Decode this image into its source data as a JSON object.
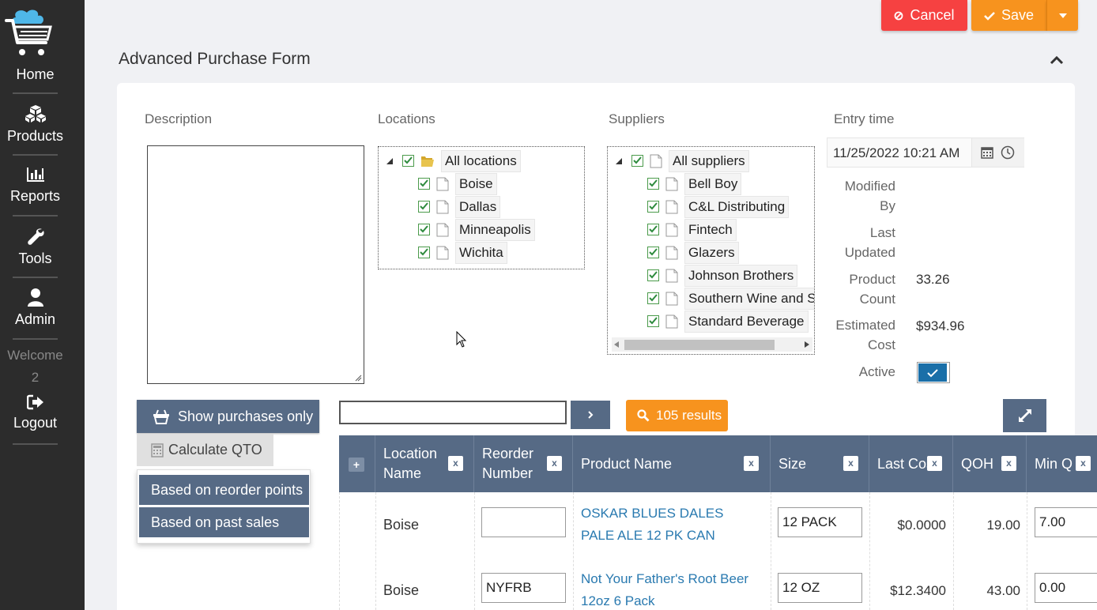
{
  "sidebar": {
    "items": [
      {
        "label": "Home",
        "icon": "cart-icon"
      },
      {
        "label": "Products",
        "icon": "boxes-icon"
      },
      {
        "label": "Reports",
        "icon": "bar-chart-icon"
      },
      {
        "label": "Tools",
        "icon": "wrench-icon"
      },
      {
        "label": "Admin",
        "icon": "user-icon"
      }
    ],
    "welcome": "Welcome",
    "user": "2",
    "logout": "Logout"
  },
  "toolbar": {
    "cancel_label": "Cancel",
    "save_label": "Save"
  },
  "form": {
    "title": "Advanced Purchase Form",
    "description_label": "Description",
    "description_value": "",
    "locations_label": "Locations",
    "locations": {
      "root": "All locations",
      "children": [
        "Boise",
        "Dallas",
        "Minneapolis",
        "Wichita"
      ]
    },
    "suppliers_label": "Suppliers",
    "suppliers": {
      "root": "All suppliers",
      "children": [
        "Bell Boy",
        "C&L Distributing",
        "Fintech",
        "Glazers",
        "Johnson Brothers",
        "Southern Wine and Sp",
        "Standard Beverage"
      ]
    },
    "entry_time_label": "Entry time",
    "entry_time_value": "11/25/2022 10:21 AM",
    "modified_by_label_1": "Modified",
    "modified_by_label_2": "By",
    "last_updated_label_1": "Last",
    "last_updated_label_2": "Updated",
    "product_count_label_1": "Product",
    "product_count_label_2": "Count",
    "product_count_value": "33.26",
    "estimated_cost_label_1": "Estimated",
    "estimated_cost_label_2": "Cost",
    "estimated_cost_value": "$934.96",
    "active_label": "Active",
    "active_value": true
  },
  "actions": {
    "show_purchases_label": "Show purchases only",
    "calculate_qto_label": "Calculate QTO",
    "qto_options": [
      "Based on reorder points",
      "Based on past sales"
    ],
    "search_value": "",
    "results_label": "105 results"
  },
  "grid": {
    "columns": [
      "Location Name",
      "Reorder Number",
      "Product Name",
      "Size",
      "Last Cost",
      "QOH",
      "Min QTY"
    ],
    "columns_display": [
      "Location",
      "Name",
      "Reorder",
      "Number",
      "Product Name",
      "Size",
      "Last Cos",
      "QOH",
      "Min Q"
    ],
    "rows": [
      {
        "location": "Boise",
        "reorder": "",
        "product_line1": "OSKAR BLUES DALES",
        "product_line2": "PALE ALE 12 PK CAN",
        "size": "12 PACK",
        "last_cost": "$0.0000",
        "qoh": "19.00",
        "min_qty": "7.00"
      },
      {
        "location": "Boise",
        "reorder": "NYFRB",
        "product_line1": "Not Your Father's Root Beer",
        "product_line2": "12oz 6 Pack",
        "size": "12 OZ",
        "last_cost": "$12.3400",
        "qoh": "43.00",
        "min_qty": "0.00"
      }
    ]
  },
  "colors": {
    "sidebar_bg": "#2c2c2c",
    "cancel": "#f64141",
    "save": "#f7931e",
    "slate": "#566a85",
    "link": "#2a7ab0",
    "active_toggle": "#1a6fa8"
  }
}
